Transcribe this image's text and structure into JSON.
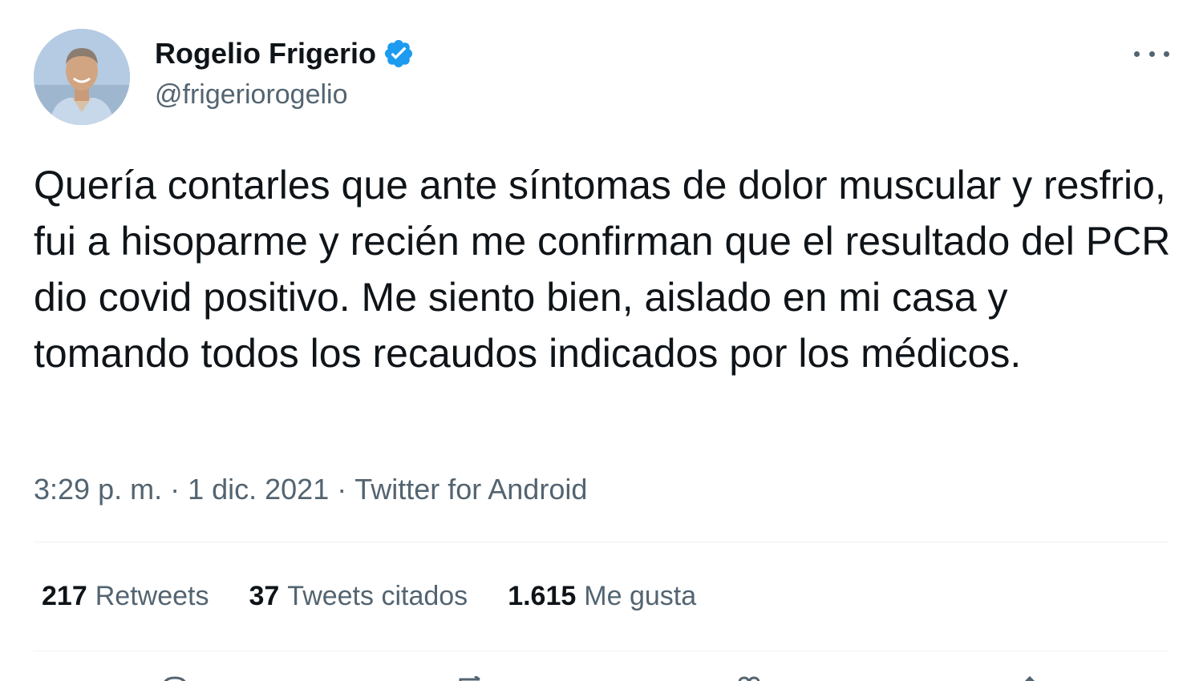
{
  "author": {
    "name": "Rogelio Frigerio",
    "handle": "@frigeriorogelio",
    "verified": true
  },
  "tweet": {
    "text": "Quería contarles que ante síntomas de dolor muscular y resfrio, fui a hisoparme y recién me confirman que el resultado del PCR dio covid positivo. Me siento bien, aislado en mi casa y tomando todos los recaudos indicados por los médicos.",
    "time": "3:29 p. m.",
    "date": "1 dic. 2021",
    "source": "Twitter for Android",
    "separator": "·"
  },
  "stats": {
    "retweets": {
      "count": "217",
      "label": "Retweets"
    },
    "quotes": {
      "count": "37",
      "label": "Tweets citados"
    },
    "likes": {
      "count": "1.615",
      "label": "Me gusta"
    }
  },
  "icons": {
    "verified": "verified-badge-icon",
    "more": "more-options-icon",
    "reply": "reply-icon",
    "retweet": "retweet-icon",
    "like": "like-icon",
    "share": "share-icon"
  },
  "colors": {
    "text_primary": "#0f1419",
    "text_secondary": "#536471",
    "verified_blue": "#1d9bf0",
    "divider": "#eff3f4"
  }
}
